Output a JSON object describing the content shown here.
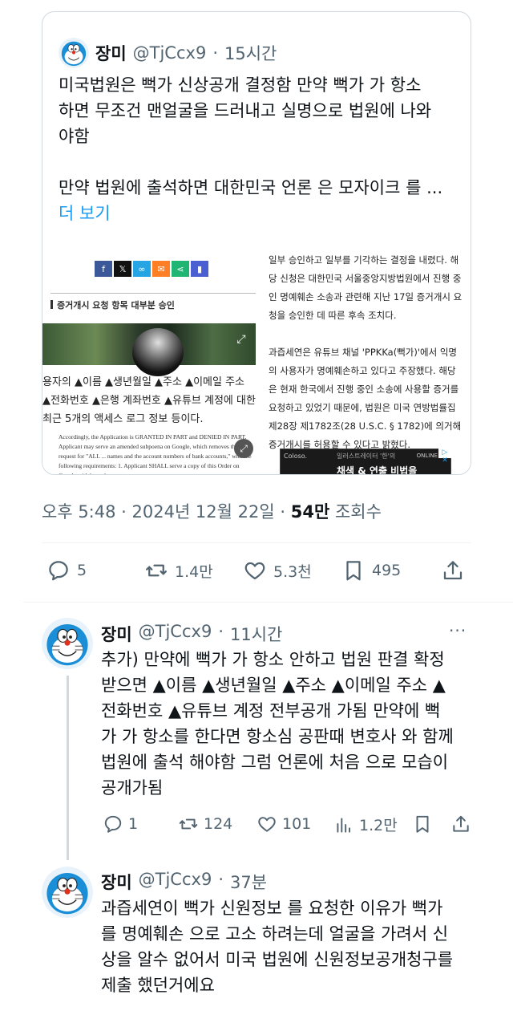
{
  "quote": {
    "name": "장미",
    "handle": "@TjCcx9",
    "dot": "·",
    "time": "15시간",
    "text": "미국법원은  뻑가 신상공개 결정함 만약 뻑가 가 항소\n하면  무조건 맨얼굴을 드러내고 실명으로 법원에 나와\n야함\n\n만약 법원에 출석하면 대한민국 언론 은 모자이크 를 ...",
    "more": "더 보기",
    "media": {
      "section_title": "증거개시 요청 항목 대부분 승인",
      "left_text": "용자의 ▲이름 ▲생년월일 ▲주소 ▲이메일 주소 ▲전화번호 ▲은행 계좌번호 ▲유튜브 계정에 대한 최근 5개의 액세스 로그 정보 등이다.",
      "en_text": "Accordingly, the Application is GRANTED IN PART and DENIED IN PART. Applicant may serve an amended subpoena on Google, which removes the request for \"ALL ... names and the account numbers of bank accounts,\" with the following requirements:\n1.  Applicant SHALL serve a copy of this Order on Google with her subpoena;",
      "right_text": "일부 승인하고 일부를 기각하는 결정을 내렸다. 해당 신청은 대한민국 서울중앙지방법원에서 진행 중인 명예훼손 소송과 관련해 지난 17일 증거개시 요청을 승인한 데 따른 후속 조치다.\n\n과즙세연은 유튜브 채널 'PPKKa(뻑가)'에서 익명의 사용자가 명예훼손하고 있다고 주장했다. 해당 은 현재 한국에서 진행 중인 소송에 사용할 증거를 요청하고 있었기 때문에, 법원은 미국 연방법률집 제28장 제1782조(28 U.S.C. § 1782)에 의거해 증거개시를 허용할 수 있다고 밝혔다.",
      "ad_label": "Coloso.",
      "ad_sub": "일러스트레이터 '한'의",
      "ad_title": "채색 & 연출 비법을",
      "ad_online": "ONLINE",
      "ad_x": "▷ ✕",
      "colors": {
        "facebook": "#3b5998",
        "x": "#111111",
        "link": "#26a5e4",
        "mail": "#ff7f27",
        "share": "#21b573",
        "bookmark": "#4a5fd1"
      }
    }
  },
  "meta": {
    "time": "오후 5:48 · 2024년 12월 22일 · ",
    "views": "54만",
    "views_label": " 조회수"
  },
  "stats": {
    "replies": "5",
    "retweets": "1.4만",
    "likes": "5.3천",
    "bookmarks": "495"
  },
  "replies": [
    {
      "name": "장미",
      "handle": "@TjCcx9",
      "dot": "·",
      "time": "11시간",
      "more": "···",
      "text": "추가) 만약에 뻑가 가 항소 안하고 법원 판결 확정\n받으면 ▲이름 ▲생년월일 ▲주소 ▲이메일 주소 ▲\n전화번호  ▲유튜브 계정  전부공개 가됨  만약에  뻑\n가 가 항소를 한다면 항소심 공판때 변호사 와 함께\n법원에 출석 해야함 그럼 언론에 처음 으로 모습이\n공개가됨",
      "replies": "1",
      "retweets": "124",
      "likes": "101",
      "views": "1.2만"
    },
    {
      "name": "장미",
      "handle": "@TjCcx9",
      "dot": "·",
      "time": "37분",
      "more": "···",
      "text": "과즙세연이  뻑가 신원정보 를 요청한 이유가  뻑가\n를 명예훼손 으로 고소 하려는데 얼굴을 가려서 신\n상을  알수 없어서 미국 법원에 신원정보공개청구를\n제출 했던거에요"
    }
  ]
}
